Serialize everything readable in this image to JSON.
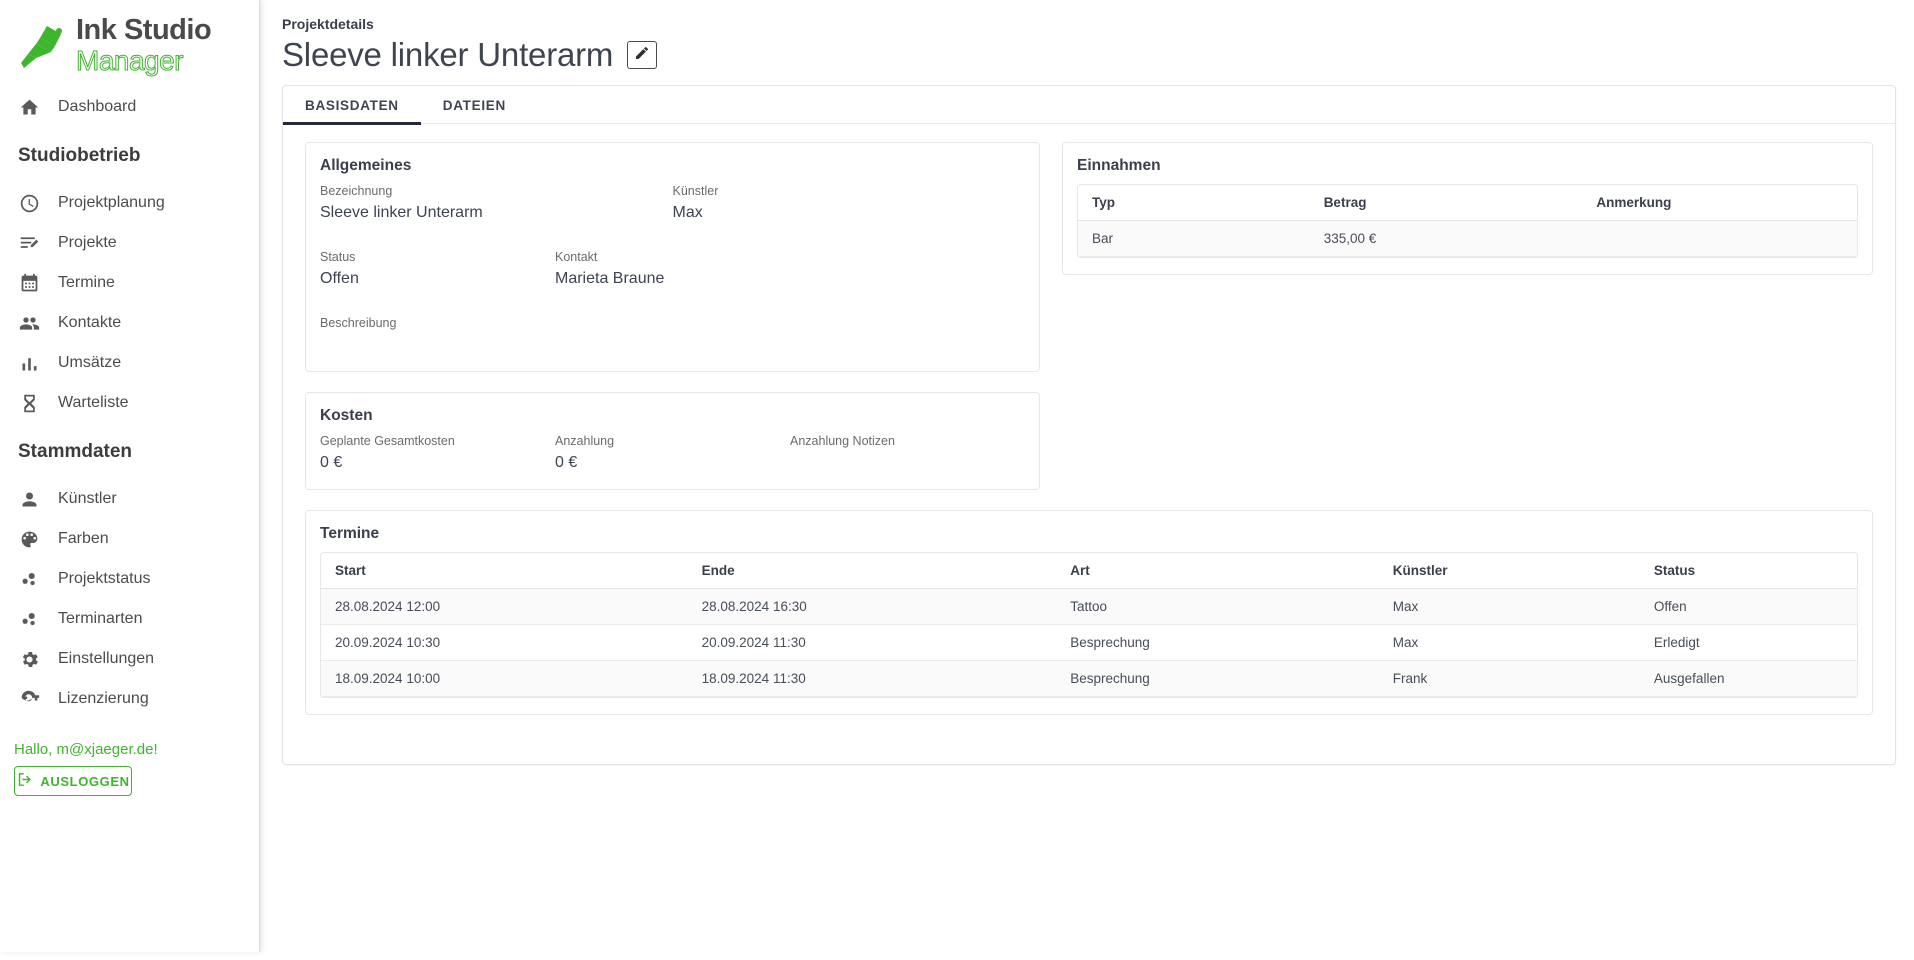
{
  "sidebar": {
    "logo": {
      "line1": "Ink Studio",
      "line2": "Manager",
      "icon": "tattoo-machine-icon"
    },
    "dashboard": {
      "label": "Dashboard",
      "icon": "home-icon"
    },
    "sections": [
      {
        "title": "Studiobetrieb",
        "items": [
          {
            "label": "Projektplanung",
            "icon": "clock-icon"
          },
          {
            "label": "Projekte",
            "icon": "list-edit-icon"
          },
          {
            "label": "Termine",
            "icon": "calendar-icon"
          },
          {
            "label": "Kontakte",
            "icon": "people-icon"
          },
          {
            "label": "Umsätze",
            "icon": "bar-chart-icon"
          },
          {
            "label": "Warteliste",
            "icon": "hourglass-icon"
          }
        ]
      },
      {
        "title": "Stammdaten",
        "items": [
          {
            "label": "Künstler",
            "icon": "person-icon"
          },
          {
            "label": "Farben",
            "icon": "palette-icon"
          },
          {
            "label": "Projektstatus",
            "icon": "bubble-chart-icon"
          },
          {
            "label": "Terminarten",
            "icon": "bubble-chart-icon"
          },
          {
            "label": "Einstellungen",
            "icon": "gear-icon"
          },
          {
            "label": "Lizenzierung",
            "icon": "key-icon"
          }
        ]
      }
    ],
    "greeting": "Hallo, m@xjaeger.de!",
    "logout_label": "AUSLOGGEN",
    "logout_icon": "logout-icon",
    "accent_color": "#3db52c"
  },
  "header": {
    "breadcrumb": "Projektdetails",
    "title": "Sleeve linker Unterarm",
    "edit_icon": "pencil-icon"
  },
  "tabs": [
    {
      "label": "BASISDATEN",
      "active": true
    },
    {
      "label": "DATEIEN",
      "active": false
    }
  ],
  "allgemeines": {
    "title": "Allgemeines",
    "bezeichnung_label": "Bezeichnung",
    "bezeichnung_value": "Sleeve linker Unterarm",
    "kuenstler_label": "Künstler",
    "kuenstler_value": "Max",
    "status_label": "Status",
    "status_value": "Offen",
    "kontakt_label": "Kontakt",
    "kontakt_value": "Marieta Braune",
    "beschreibung_label": "Beschreibung",
    "beschreibung_value": ""
  },
  "kosten": {
    "title": "Kosten",
    "gesamtkosten_label": "Geplante Gesamtkosten",
    "gesamtkosten_value": "0 €",
    "anzahlung_label": "Anzahlung",
    "anzahlung_value": "0 €",
    "anzahlung_notizen_label": "Anzahlung Notizen",
    "anzahlung_notizen_value": ""
  },
  "einnahmen": {
    "title": "Einnahmen",
    "columns": [
      "Typ",
      "Betrag",
      "Anmerkung"
    ],
    "rows": [
      {
        "typ": "Bar",
        "betrag": "335,00 €",
        "anmerkung": ""
      }
    ]
  },
  "termine": {
    "title": "Termine",
    "columns": [
      "Start",
      "Ende",
      "Art",
      "Künstler",
      "Status"
    ],
    "rows": [
      {
        "start": "28.08.2024 12:00",
        "ende": "28.08.2024 16:30",
        "art": "Tattoo",
        "kuenstler": "Max",
        "status": "Offen"
      },
      {
        "start": "20.09.2024 10:30",
        "ende": "20.09.2024 11:30",
        "art": "Besprechung",
        "kuenstler": "Max",
        "status": "Erledigt"
      },
      {
        "start": "18.09.2024 10:00",
        "ende": "18.09.2024 11:30",
        "art": "Besprechung",
        "kuenstler": "Frank",
        "status": "Ausgefallen"
      }
    ]
  }
}
